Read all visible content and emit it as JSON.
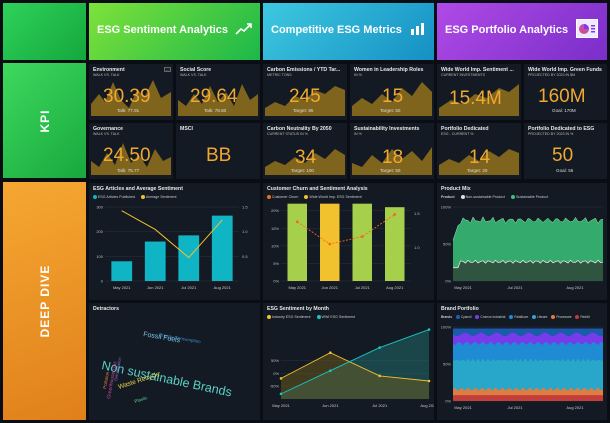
{
  "sections": {
    "kpi": "KPI",
    "deep_dive": "DEEP DIVE"
  },
  "banners": [
    {
      "title": "ESG Sentiment Analytics",
      "icon": "trend-chart-icon"
    },
    {
      "title": "Competitive ESG Metrics",
      "icon": "bar-chart-icon"
    },
    {
      "title": "ESG Portfolio Analytics",
      "icon": "pie-chart-icon"
    }
  ],
  "kpis": {
    "environment": {
      "title": "Environment",
      "subtitle": "WALK VS. TALK",
      "value": "30.39",
      "goal": "Talk: 77.91"
    },
    "social": {
      "title": "Social Score",
      "subtitle": "WALK VS. TALK",
      "value": "29.64",
      "goal": "Talk: 78.60"
    },
    "carbon": {
      "title": "Carbon Emissions / YTD Tar...",
      "subtitle": "METRIC TONS",
      "value": "245",
      "goal": "Target: 95"
    },
    "women": {
      "title": "Women in Leadership Roles",
      "subtitle": "IN %",
      "value": "15",
      "goal": "Target: 50"
    },
    "sentiment": {
      "title": "Wide World Imp. Sentiment ...",
      "subtitle": "CURRENT INVESTMENTS",
      "value": "15.4M",
      "goal": ""
    },
    "green_funds": {
      "title": "Wide World Imp. Green Funds",
      "subtitle": "PROJECTED BY 2023 IN $M",
      "value": "160M",
      "goal": "Goal: 170M"
    },
    "governance": {
      "title": "Governance",
      "subtitle": "WALK VS. TALK",
      "value": "24.50",
      "goal": "Talk: 75.77"
    },
    "msci": {
      "title": "MSCI",
      "subtitle": "",
      "value": "BB",
      "goal": ""
    },
    "neutrality": {
      "title": "Carbon Neutrality By 2050",
      "subtitle": "CURRENT STATUS IN %",
      "value": "34",
      "goal": "Target: 100"
    },
    "sust_invest": {
      "title": "Sustainability Investments",
      "subtitle": "IN %",
      "value": "18",
      "goal": "Target: 50"
    },
    "portfolio": {
      "title": "Portfolio Dedicated",
      "subtitle": "ESG - CURRENT %",
      "value": "14",
      "goal": "Target: 20"
    },
    "portfolio_proj": {
      "title": "Portfolio Dedicated to ESG",
      "subtitle": "PROJECTED BY 2023 IN %",
      "value": "50",
      "goal": "Goal: 55"
    }
  },
  "panels": {
    "articles": {
      "title": "ESG Articles and Average Sentiment",
      "legend": [
        "ESG Articles Published",
        "Average Sentiment"
      ]
    },
    "churn": {
      "title": "Customer Churn and Sentiment Analysis",
      "legend": [
        "Customer Churn",
        "Wide World Imp. ESG Sentiment"
      ]
    },
    "product_mix": {
      "title": "Product Mix",
      "legend_label": "Product",
      "legend": [
        "Non-sustainable Product",
        "Sustainable Product"
      ]
    },
    "detractors": {
      "title": "Detractors"
    },
    "by_month": {
      "title": "ESG Sentiment by Month",
      "legend": [
        "Industry ESG Sentiment",
        "WWI ESG Sentiment"
      ]
    },
    "brand": {
      "title": "Brand Portfolio",
      "legend_label": "Brands",
      "legend": [
        "Cyanoll",
        "Cromos Industrial",
        "Palatikum",
        "Litware",
        "Proseware",
        "Reddit"
      ]
    }
  },
  "wordcloud": [
    {
      "text": "Non sustainable Brands",
      "color": "#5ad1c8"
    },
    {
      "text": "Energy Consumption",
      "color": "#3a8fd1"
    },
    {
      "text": "Fossil Fuels",
      "color": "#7ec3e6"
    },
    {
      "text": "Waste Recycle",
      "color": "#e8d84a"
    },
    {
      "text": "Greenhouse Gas",
      "color": "#c94ea0"
    },
    {
      "text": "Pollution",
      "color": "#e87a3a"
    },
    {
      "text": "Deforestation",
      "color": "#8a6fd1"
    },
    {
      "text": "Plastic",
      "color": "#5ad18a"
    }
  ],
  "chart_data": [
    {
      "type": "bar",
      "title": "ESG Articles and Average Sentiment",
      "categories": [
        "May 2021",
        "Jun 2021",
        "Jul 2021",
        "Aug 2021"
      ],
      "series": [
        {
          "name": "ESG Articles Published",
          "values": [
            80,
            160,
            185,
            265
          ],
          "color": "#0fb5c4"
        },
        {
          "name": "Average Sentiment",
          "values": [
            1.5,
            1.1,
            0.5,
            1.3
          ],
          "color": "#f2c12e"
        }
      ],
      "ylim": [
        0,
        300
      ],
      "yticks": [
        "0",
        "100",
        "200",
        "300"
      ],
      "y2ticks": [
        "0.5",
        "1.0",
        "1.5"
      ]
    },
    {
      "type": "bar",
      "title": "Customer Churn and Sentiment Analysis",
      "categories": [
        "May 2021",
        "Jun 2021",
        "Jul 2021",
        "Aug 2021"
      ],
      "series": [
        {
          "name": "Customer Churn",
          "values": [
            22,
            22,
            22,
            21
          ],
          "colors": [
            "#a6d04c",
            "#f2c12e",
            "#a6d04c",
            "#a6d04c"
          ]
        },
        {
          "name": "Wide World Imp. ESG Sentiment",
          "values": [
            1.4,
            1.1,
            1.2,
            1.5
          ],
          "color": "#f26b1d"
        }
      ],
      "yticks": [
        "0%",
        "5%",
        "10%",
        "15%",
        "20%"
      ],
      "y2ticks": [
        "1.0",
        "1.5"
      ]
    },
    {
      "type": "area",
      "title": "Product Mix",
      "x": [
        "May 2021",
        "Jul 2021",
        "Aug 2021"
      ],
      "series": [
        {
          "name": "Non-sustainable Product",
          "color": "#e0e0e0"
        },
        {
          "name": "Sustainable Product",
          "color": "#3ac47a"
        }
      ],
      "yticks": [
        "0%",
        "50%",
        "100%"
      ]
    },
    {
      "type": "line",
      "title": "ESG Sentiment by Month",
      "categories": [
        "May 2021",
        "Jun 2021",
        "Jul 2021",
        "Aug 2021"
      ],
      "series": [
        {
          "name": "Industry ESG Sentiment",
          "values": [
            -20,
            80,
            -10,
            -30
          ],
          "color": "#f2c12e"
        },
        {
          "name": "WWI ESG Sentiment",
          "values": [
            -80,
            10,
            100,
            170
          ],
          "color": "#17c5c5"
        }
      ],
      "yticks": [
        "-50%",
        "0%",
        "50%"
      ]
    },
    {
      "type": "area",
      "title": "Brand Portfolio",
      "x": [
        "May 2021",
        "Jul 2021",
        "Aug 2021"
      ],
      "series": [
        {
          "name": "Cyanoll",
          "color": "#1a5fb4"
        },
        {
          "name": "Cromos Industrial",
          "color": "#7c3aed"
        },
        {
          "name": "Palatikum",
          "color": "#1a8fd1"
        },
        {
          "name": "Litware",
          "color": "#2aa9c9"
        },
        {
          "name": "Proseware",
          "color": "#e87a3a"
        },
        {
          "name": "Reddit",
          "color": "#c13b3b"
        }
      ],
      "yticks": [
        "0%",
        "50%",
        "100%"
      ]
    }
  ]
}
